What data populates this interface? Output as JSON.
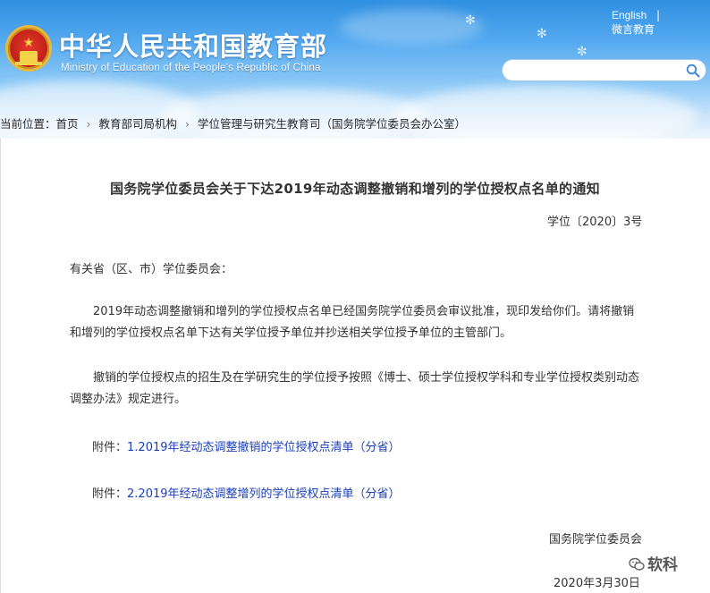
{
  "header": {
    "title_cn": "中华人民共和国教育部",
    "title_en": "Ministry of Education of the People's Republic of China",
    "links": {
      "english": "English",
      "separator": "|",
      "weibo": "微言教育"
    },
    "search": {
      "placeholder": "",
      "icon": "search-icon"
    }
  },
  "breadcrumb": {
    "label": "当前位置：",
    "items": [
      "首页",
      "教育部司局机构",
      "学位管理与研究生教育司（国务院学位委员会办公室）"
    ]
  },
  "document": {
    "title": "国务院学位委员会关于下达2019年动态调整撤销和增列的学位授权点名单的通知",
    "number": "学位〔2020〕3号",
    "salutation": "有关省（区、市）学位委员会：",
    "paragraphs": [
      "2019年动态调整撤销和增列的学位授权点名单已经国务院学位委员会审议批准，现印发给你们。请将撤销和增列的学位授权点名单下达有关学位授予单位并抄送相关学位授予单位的主管部门。",
      "撤销的学位授权点的招生及在学研究生的学位授予按照《博士、硕士学位授权学科和专业学位授权类别动态调整办法》规定进行。"
    ],
    "attachments": [
      {
        "prefix": "附件：",
        "link": "1.2019年经动态调整撤销的学位授权点清单（分省）"
      },
      {
        "prefix": "附件：",
        "link": "2.2019年经动态调整增列的学位授权点清单（分省）"
      }
    ],
    "signer": "国务院学位委员会",
    "date": "2020年3月30日"
  },
  "watermark": {
    "text": "软科"
  },
  "colors": {
    "header_top": "#2f8fe0",
    "link": "#1a3fb8",
    "text": "#333333"
  }
}
